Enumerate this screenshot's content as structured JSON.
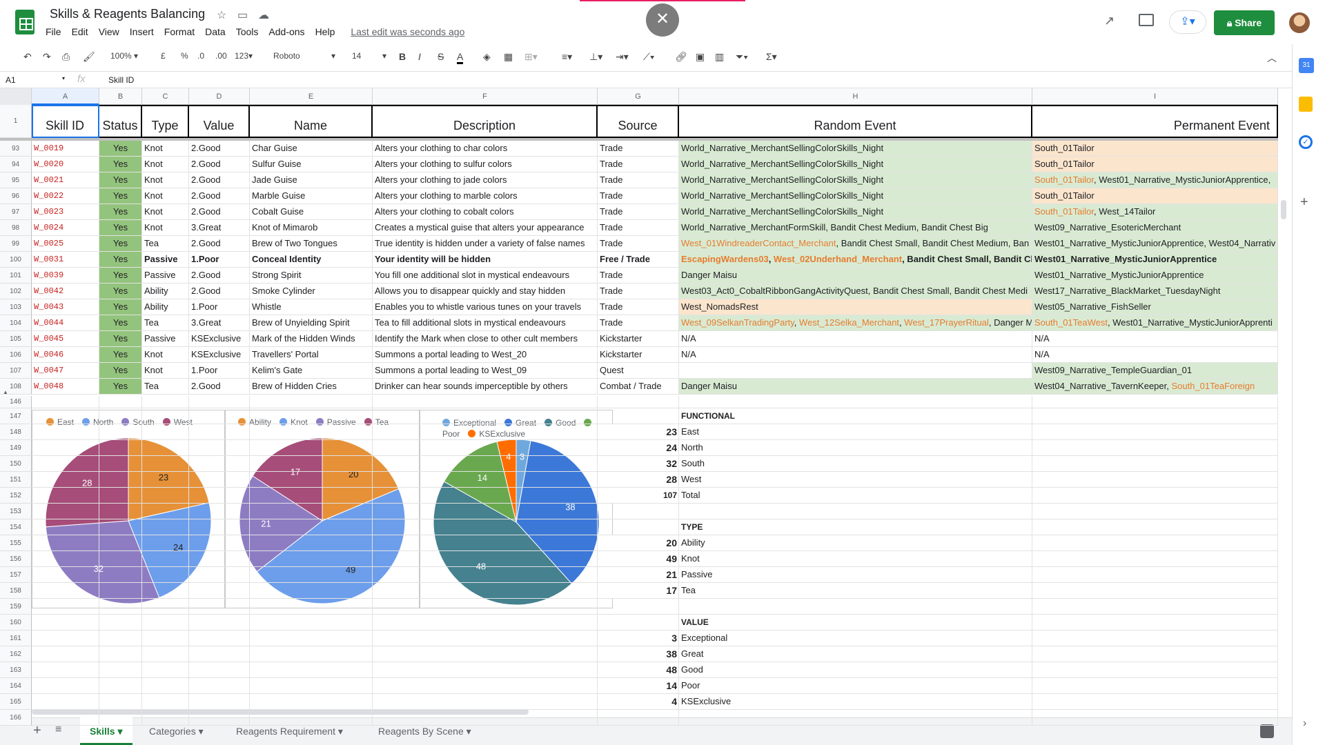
{
  "app": {
    "doc_title": "Skills & Reagents Balancing",
    "menus": [
      "File",
      "Edit",
      "View",
      "Insert",
      "Format",
      "Data",
      "Tools",
      "Add-ons",
      "Help"
    ],
    "last_edit": "Last edit was seconds ago",
    "share_label": "Share",
    "close_symbol": "✕"
  },
  "toolbar": {
    "zoom": "100%",
    "currency": "£",
    "percent": "%",
    "dec_less": ".0",
    "dec_more": ".00",
    "more_formats": "123",
    "font": "Roboto",
    "font_size": "14"
  },
  "formula_bar": {
    "cell_ref": "A1",
    "fx": "fx",
    "value": "Skill ID"
  },
  "columns": [
    "A",
    "B",
    "C",
    "D",
    "E",
    "F",
    "G",
    "H",
    "I"
  ],
  "headers": [
    "Skill ID",
    "Status",
    "Type",
    "Value",
    "Name",
    "Description",
    "Source",
    "Random Event",
    "Permanent Event"
  ],
  "rows": [
    {
      "n": "93",
      "id": "W_0019",
      "status": "Yes",
      "type": "Knot",
      "value": "2.Good",
      "name": "Char Guise",
      "desc": "Alters your clothing to char colors",
      "source": "Trade",
      "h": [
        {
          "t": "World_Narrative_MerchantSellingColorSkills_Night"
        }
      ],
      "i": [
        {
          "t": "South_01Tailor"
        }
      ],
      "hbg": "green",
      "ibg": "peach"
    },
    {
      "n": "94",
      "id": "W_0020",
      "status": "Yes",
      "type": "Knot",
      "value": "2.Good",
      "name": "Sulfur Guise",
      "desc": "Alters your clothing to sulfur colors",
      "source": "Trade",
      "h": [
        {
          "t": "World_Narrative_MerchantSellingColorSkills_Night"
        }
      ],
      "i": [
        {
          "t": "South_01Tailor"
        }
      ],
      "hbg": "green",
      "ibg": "peach"
    },
    {
      "n": "95",
      "id": "W_0021",
      "status": "Yes",
      "type": "Knot",
      "value": "2.Good",
      "name": "Jade Guise",
      "desc": "Alters your clothing to jade colors",
      "source": "Trade",
      "h": [
        {
          "t": "World_Narrative_MerchantSellingColorSkills_Night"
        }
      ],
      "i": [
        {
          "t": "South_01Tailor",
          "c": "orange"
        },
        {
          "t": ", West01_Narrative_MysticJuniorApprentice,"
        }
      ],
      "hbg": "green",
      "ibg": "green"
    },
    {
      "n": "96",
      "id": "W_0022",
      "status": "Yes",
      "type": "Knot",
      "value": "2.Good",
      "name": "Marble Guise",
      "desc": "Alters your clothing to marble colors",
      "source": "Trade",
      "h": [
        {
          "t": "World_Narrative_MerchantSellingColorSkills_Night"
        }
      ],
      "i": [
        {
          "t": "South_01Tailor"
        }
      ],
      "hbg": "green",
      "ibg": "peach"
    },
    {
      "n": "97",
      "id": "W_0023",
      "status": "Yes",
      "type": "Knot",
      "value": "2.Good",
      "name": "Cobalt Guise",
      "desc": "Alters your clothing to cobalt colors",
      "source": "Trade",
      "h": [
        {
          "t": "World_Narrative_MerchantSellingColorSkills_Night"
        }
      ],
      "i": [
        {
          "t": "South_01Tailor",
          "c": "orange"
        },
        {
          "t": ", West_14Tailor"
        }
      ],
      "hbg": "green",
      "ibg": "green"
    },
    {
      "n": "98",
      "id": "W_0024",
      "status": "Yes",
      "type": "Knot",
      "value": "3.Great",
      "name": "Knot of Mimarob",
      "desc": "Creates a mystical guise that alters your appearance",
      "source": "Trade",
      "h": [
        {
          "t": "World_Narrative_MerchantFormSkill, Bandit Chest Medium, Bandit Chest Big"
        }
      ],
      "i": [
        {
          "t": "West09_Narrative_EsotericMerchant"
        }
      ],
      "hbg": "green",
      "ibg": "green"
    },
    {
      "n": "99",
      "id": "W_0025",
      "status": "Yes",
      "type": "Tea",
      "value": "2.Good",
      "name": "Brew of Two Tongues",
      "desc": "True identity is hidden under a variety of false names",
      "source": "Trade",
      "h": [
        {
          "t": "West_01WindreaderContact_Merchant",
          "c": "orange"
        },
        {
          "t": ", Bandit Chest Small, Bandit Chest Medium, Ban"
        }
      ],
      "i": [
        {
          "t": "West01_Narrative_MysticJuniorApprentice, West04_Narrativ"
        }
      ],
      "hbg": "green",
      "ibg": "green"
    },
    {
      "n": "100",
      "id": "W_0031",
      "status": "Yes",
      "type": "Passive",
      "value": "1.Poor",
      "name": "Conceal Identity",
      "desc": "Your identity will be hidden",
      "source": "Free / Trade",
      "bold": true,
      "h": [
        {
          "t": "EscapingWardens03",
          "c": "orange"
        },
        {
          "t": ", "
        },
        {
          "t": "West_02Underhand_Merchant",
          "c": "orange"
        },
        {
          "t": ", Bandit Chest Small, Bandit Ches"
        }
      ],
      "i": [
        {
          "t": "West01_Narrative_MysticJuniorApprentice"
        }
      ],
      "hbg": "green",
      "ibg": "green"
    },
    {
      "n": "101",
      "id": "W_0039",
      "status": "Yes",
      "type": "Passive",
      "value": "2.Good",
      "name": "Strong Spirit",
      "desc": "You fill one additional slot in mystical endeavours",
      "source": "Trade",
      "h": [
        {
          "t": "Danger Maisu"
        }
      ],
      "i": [
        {
          "t": "West01_Narrative_MysticJuniorApprentice"
        }
      ],
      "hbg": "green",
      "ibg": "green"
    },
    {
      "n": "102",
      "id": "W_0042",
      "status": "Yes",
      "type": "Ability",
      "value": "2.Good",
      "name": "Smoke Cylinder",
      "desc": "Allows you to disappear quickly and stay hidden",
      "source": "Trade",
      "h": [
        {
          "t": "West03_Act0_CobaltRibbonGangActivityQuest, Bandit Chest Small, Bandit Chest Medi"
        }
      ],
      "i": [
        {
          "t": "West17_Narrative_BlackMarket_TuesdayNight"
        }
      ],
      "hbg": "green",
      "ibg": "green"
    },
    {
      "n": "103",
      "id": "W_0043",
      "status": "Yes",
      "type": "Ability",
      "value": "1.Poor",
      "name": "Whistle",
      "desc": "Enables you to whistle various tunes on your travels",
      "source": "Trade",
      "h": [
        {
          "t": "West_NomadsRest"
        }
      ],
      "i": [
        {
          "t": "West05_Narrative_FishSeller"
        }
      ],
      "hbg": "peach",
      "ibg": "green"
    },
    {
      "n": "104",
      "id": "W_0044",
      "status": "Yes",
      "type": "Tea",
      "value": "3.Great",
      "name": "Brew of Unyielding Spirit",
      "desc": "Tea to fill additional slots in mystical endeavours",
      "source": "Trade",
      "h": [
        {
          "t": "West_09SelkanTradingParty",
          "c": "orange"
        },
        {
          "t": ", "
        },
        {
          "t": "West_12Selka_Merchant",
          "c": "orange"
        },
        {
          "t": ", "
        },
        {
          "t": "West_17PrayerRitual",
          "c": "orange"
        },
        {
          "t": ", Danger M"
        }
      ],
      "i": [
        {
          "t": "South_01TeaWest",
          "c": "orange"
        },
        {
          "t": ", West01_Narrative_MysticJuniorApprenti"
        }
      ],
      "hbg": "green",
      "ibg": "green"
    },
    {
      "n": "105",
      "id": "W_0045",
      "status": "Yes",
      "type": "Passive",
      "value": "KSExclusive",
      "name": "Mark of the Hidden Winds",
      "desc": "Identify the Mark when close to other cult members",
      "source": "Kickstarter",
      "h": [
        {
          "t": "N/A"
        }
      ],
      "i": [
        {
          "t": "N/A"
        }
      ],
      "hbg": "",
      "ibg": ""
    },
    {
      "n": "106",
      "id": "W_0046",
      "status": "Yes",
      "type": "Knot",
      "value": "KSExclusive",
      "name": "Travellers' Portal",
      "desc": "Summons a portal leading to West_20",
      "source": "Kickstarter",
      "h": [
        {
          "t": "N/A"
        }
      ],
      "i": [
        {
          "t": "N/A"
        }
      ],
      "hbg": "",
      "ibg": ""
    },
    {
      "n": "107",
      "id": "W_0047",
      "status": "Yes",
      "type": "Knot",
      "value": "1.Poor",
      "name": "Kelim's Gate",
      "desc": "Summons a portal leading to West_09",
      "source": "Quest",
      "h": [
        {
          "t": ""
        }
      ],
      "i": [
        {
          "t": "West09_Narrative_TempleGuardian_01"
        }
      ],
      "hbg": "",
      "ibg": "green"
    },
    {
      "n": "108",
      "id": "W_0048",
      "status": "Yes",
      "type": "Tea",
      "value": "2.Good",
      "name": "Brew of Hidden Cries",
      "desc": "Drinker can hear sounds imperceptible by others",
      "source": "Combat / Trade",
      "h": [
        {
          "t": "Danger Maisu"
        }
      ],
      "i": [
        {
          "t": "West04_Narrative_TavernKeeper, "
        },
        {
          "t": "South_01TeaForeign",
          "c": "orange"
        }
      ],
      "hbg": "green",
      "ibg": "green"
    }
  ],
  "lower_rows": [
    "146",
    "147",
    "148",
    "149",
    "150",
    "151",
    "152",
    "153",
    "154",
    "155",
    "156",
    "157",
    "158",
    "159",
    "160",
    "161",
    "162",
    "163",
    "164",
    "165",
    "166"
  ],
  "summary": [
    {
      "row": "147",
      "label": "FUNCTIONAL",
      "num": "",
      "bold": true
    },
    {
      "row": "148",
      "label": "East",
      "num": "23"
    },
    {
      "row": "149",
      "label": "North",
      "num": "24"
    },
    {
      "row": "150",
      "label": "South",
      "num": "32"
    },
    {
      "row": "151",
      "label": "West",
      "num": "28"
    },
    {
      "row": "152",
      "label": "Total",
      "num": "107",
      "small": true
    },
    {
      "row": "154",
      "label": "TYPE",
      "num": "",
      "bold": true
    },
    {
      "row": "155",
      "label": "Ability",
      "num": "20"
    },
    {
      "row": "156",
      "label": "Knot",
      "num": "49"
    },
    {
      "row": "157",
      "label": "Passive",
      "num": "21"
    },
    {
      "row": "158",
      "label": "Tea",
      "num": "17"
    },
    {
      "row": "160",
      "label": "VALUE",
      "num": "",
      "bold": true
    },
    {
      "row": "161",
      "label": "Exceptional",
      "num": "3"
    },
    {
      "row": "162",
      "label": "Great",
      "num": "38"
    },
    {
      "row": "163",
      "label": "Good",
      "num": "48"
    },
    {
      "row": "164",
      "label": "Poor",
      "num": "14"
    },
    {
      "row": "165",
      "label": "KSExclusive",
      "num": "4"
    }
  ],
  "chart_data": [
    {
      "type": "pie",
      "categories": [
        "East",
        "North",
        "South",
        "West"
      ],
      "values": [
        23,
        24,
        32,
        28
      ],
      "colors": [
        "#e69138",
        "#6d9eeb",
        "#8e7cc3",
        "#a64d79"
      ],
      "legend": "top"
    },
    {
      "type": "pie",
      "categories": [
        "Ability",
        "Knot",
        "Passive",
        "Tea"
      ],
      "values": [
        20,
        49,
        21,
        17
      ],
      "colors": [
        "#e69138",
        "#6d9eeb",
        "#8e7cc3",
        "#a64d79"
      ],
      "legend": "top"
    },
    {
      "type": "pie",
      "categories": [
        "Exceptional",
        "Great",
        "Good",
        "Poor",
        "KSExclusive"
      ],
      "values": [
        3,
        38,
        48,
        14,
        4
      ],
      "colors": [
        "#6fa8dc",
        "#3c78d8",
        "#45818e",
        "#6aa84f",
        "#ff6d01"
      ],
      "legend": "top"
    }
  ],
  "tabs": [
    "Skills",
    "Categories",
    "Reagents Requirement",
    "Reagents By Scene"
  ]
}
